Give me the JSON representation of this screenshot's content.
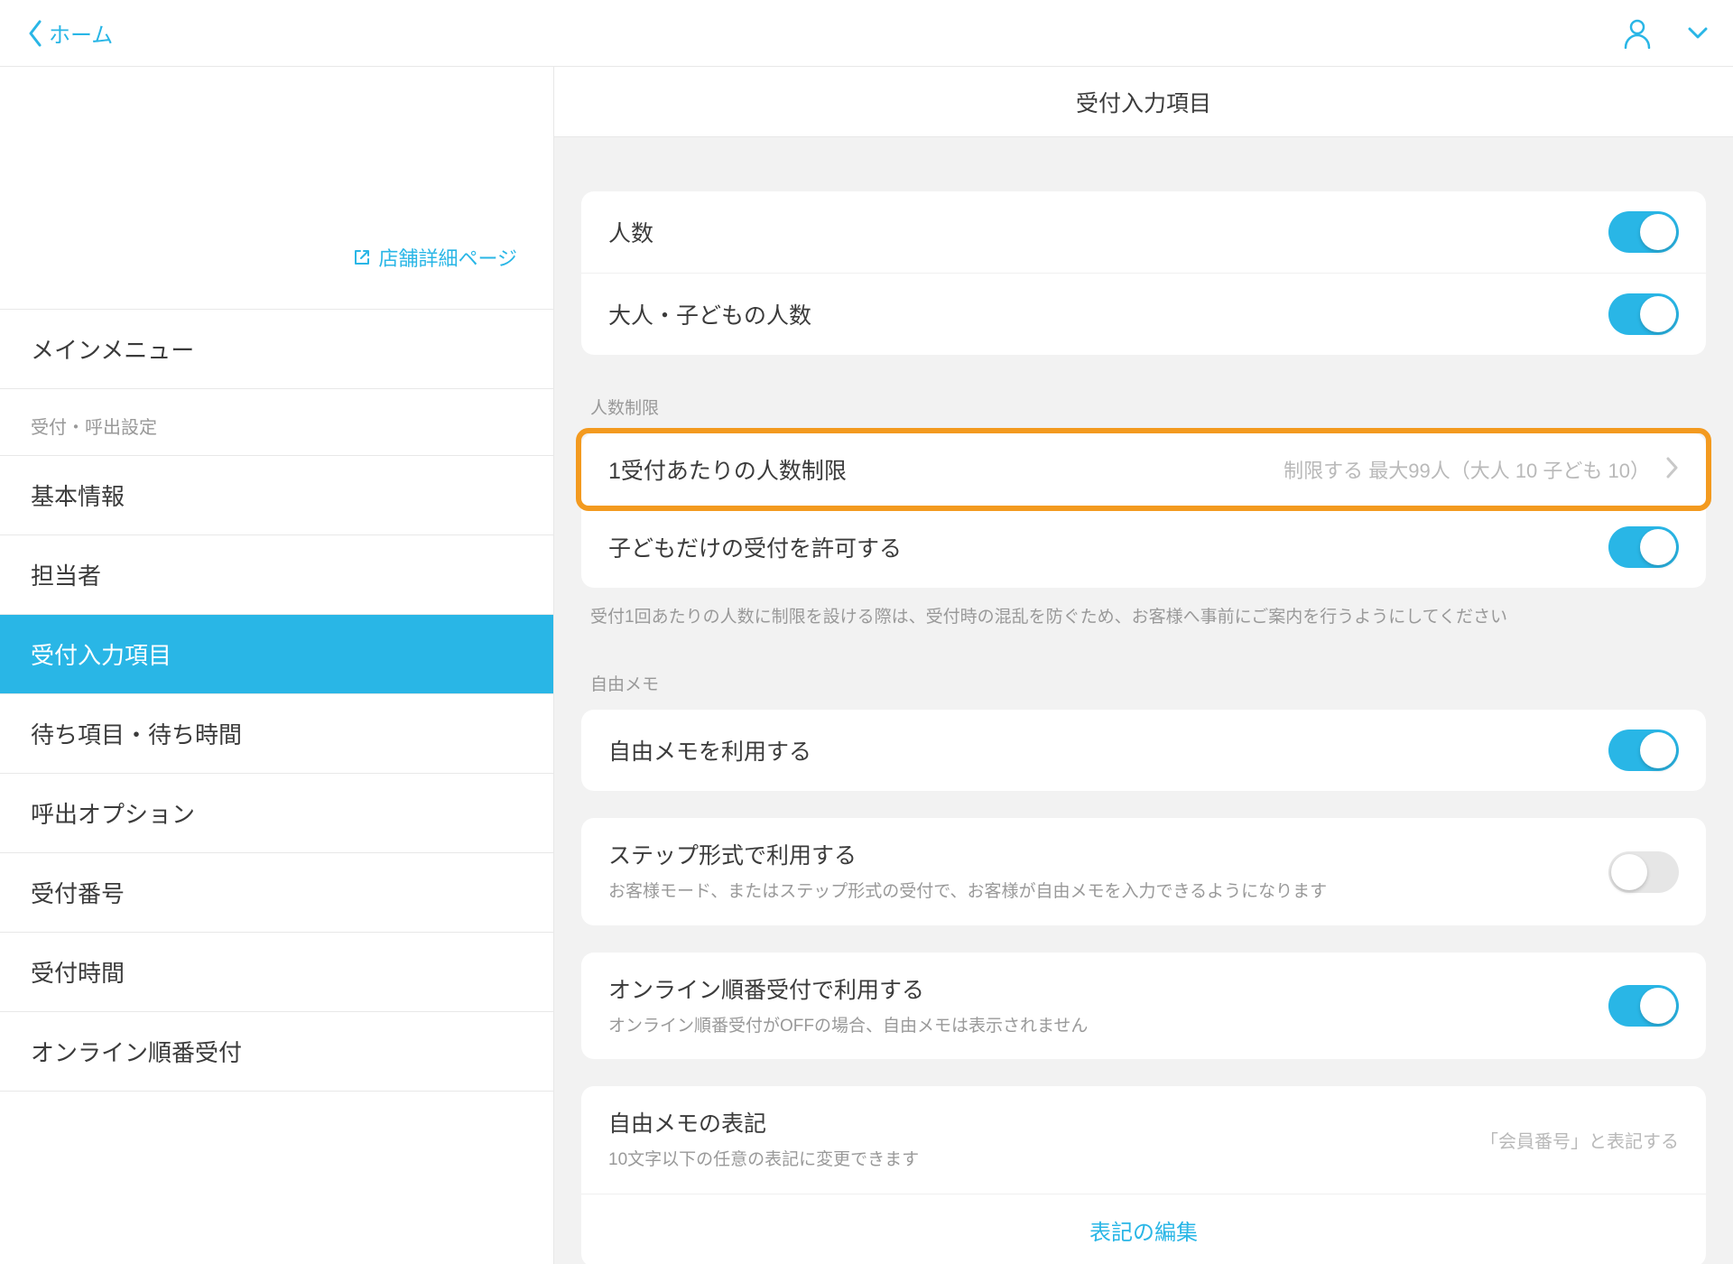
{
  "header": {
    "back_label": "ホーム"
  },
  "sidebar": {
    "store_link": "店舗詳細ページ",
    "main_menu": "メインメニュー",
    "section_label": "受付・呼出設定",
    "items": [
      "基本情報",
      "担当者",
      "受付入力項目",
      "待ち項目・待ち時間",
      "呼出オプション",
      "受付番号",
      "受付時間",
      "オンライン順番受付"
    ]
  },
  "content": {
    "title": "受付入力項目",
    "group1": {
      "row1": "人数",
      "row2": "大人・子どもの人数"
    },
    "group2": {
      "label": "人数制限",
      "row1": {
        "title": "1受付あたりの人数制限",
        "value": "制限する 最大99人（大人 10 子ども 10）"
      },
      "row2": "子どもだけの受付を許可する",
      "footnote": "受付1回あたりの人数に制限を設ける際は、受付時の混乱を防ぐため、お客様へ事前にご案内を行うようにしてください"
    },
    "group3": {
      "label": "自由メモ",
      "row1": "自由メモを利用する"
    },
    "group4": {
      "row1": {
        "title": "ステップ形式で利用する",
        "sub": "お客様モード、またはステップ形式の受付で、お客様が自由メモを入力できるようになります"
      }
    },
    "group5": {
      "row1": {
        "title": "オンライン順番受付で利用する",
        "sub": "オンライン順番受付がOFFの場合、自由メモは表示されません"
      }
    },
    "group6": {
      "row1": {
        "title": "自由メモの表記",
        "sub": "10文字以下の任意の表記に変更できます",
        "value": "「会員番号」と表記する"
      },
      "row2": "表記の編集"
    }
  }
}
